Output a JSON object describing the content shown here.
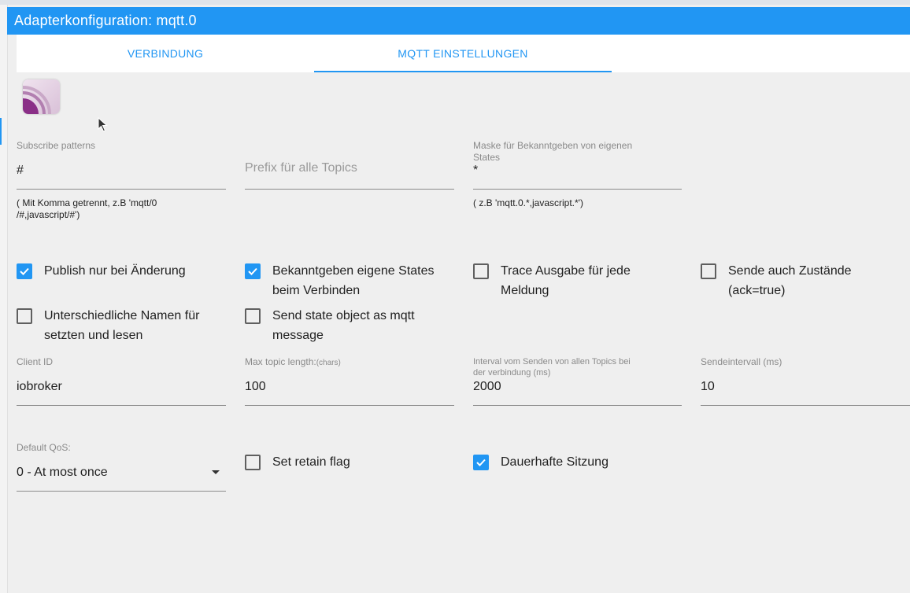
{
  "window": {
    "title": "Adapterkonfiguration: mqtt.0"
  },
  "tabs": [
    {
      "label": "VERBINDUNG",
      "active": false
    },
    {
      "label": "MQTT EINSTELLUNGEN",
      "active": true
    }
  ],
  "colors": {
    "accent": "#2196f3",
    "background": "#efefef"
  },
  "fields": {
    "subscribe": {
      "label": "Subscribe patterns",
      "value": "#",
      "hint_line1": "( Mit Komma getrennt, z.B 'mqtt/0",
      "hint_line2": "/#,javascript/#')"
    },
    "prefix": {
      "placeholder": "Prefix für alle Topics"
    },
    "mask": {
      "label_line1": "Maske für Bekanntgeben von eigenen",
      "label_line2": "States",
      "value": "*",
      "hint": "( z.B 'mqtt.0.*,javascript.*')"
    },
    "client_id": {
      "label": "Client ID",
      "value": "iobroker"
    },
    "max_topic": {
      "label": "Max topic length:",
      "label_unit": "(chars)",
      "value": "100"
    },
    "interval_all": {
      "label_line1": "Interval vom Senden von allen Topics bei",
      "label_line2": "der verbindung (ms)",
      "value": "2000"
    },
    "send_interval": {
      "label": "Sendeintervall (ms)",
      "value": "10"
    },
    "qos": {
      "label": "Default QoS:",
      "value": "0 - At most once"
    }
  },
  "checkboxes": {
    "publish_on_change": {
      "line1": "Publish nur bei Änderung",
      "line2": "",
      "checked": true
    },
    "announce_states": {
      "line1": "Bekanntgeben eigene States",
      "line2": "beim Verbinden",
      "checked": true
    },
    "trace_output": {
      "line1": "Trace Ausgabe für jede",
      "line2": "Meldung",
      "checked": false
    },
    "send_ack": {
      "line1": "Sende auch Zustände",
      "line2": "(ack=true)",
      "checked": false
    },
    "different_names": {
      "line1": "Unterschiedliche Namen für",
      "line2": "setzten und lesen",
      "checked": false
    },
    "state_object": {
      "line1": "Send state object as mqtt",
      "line2": "message",
      "checked": false
    },
    "retain_flag": {
      "line1": "Set retain flag",
      "line2": "",
      "checked": false
    },
    "persistent_session": {
      "line1": "Dauerhafte Sitzung",
      "line2": "",
      "checked": true
    }
  }
}
